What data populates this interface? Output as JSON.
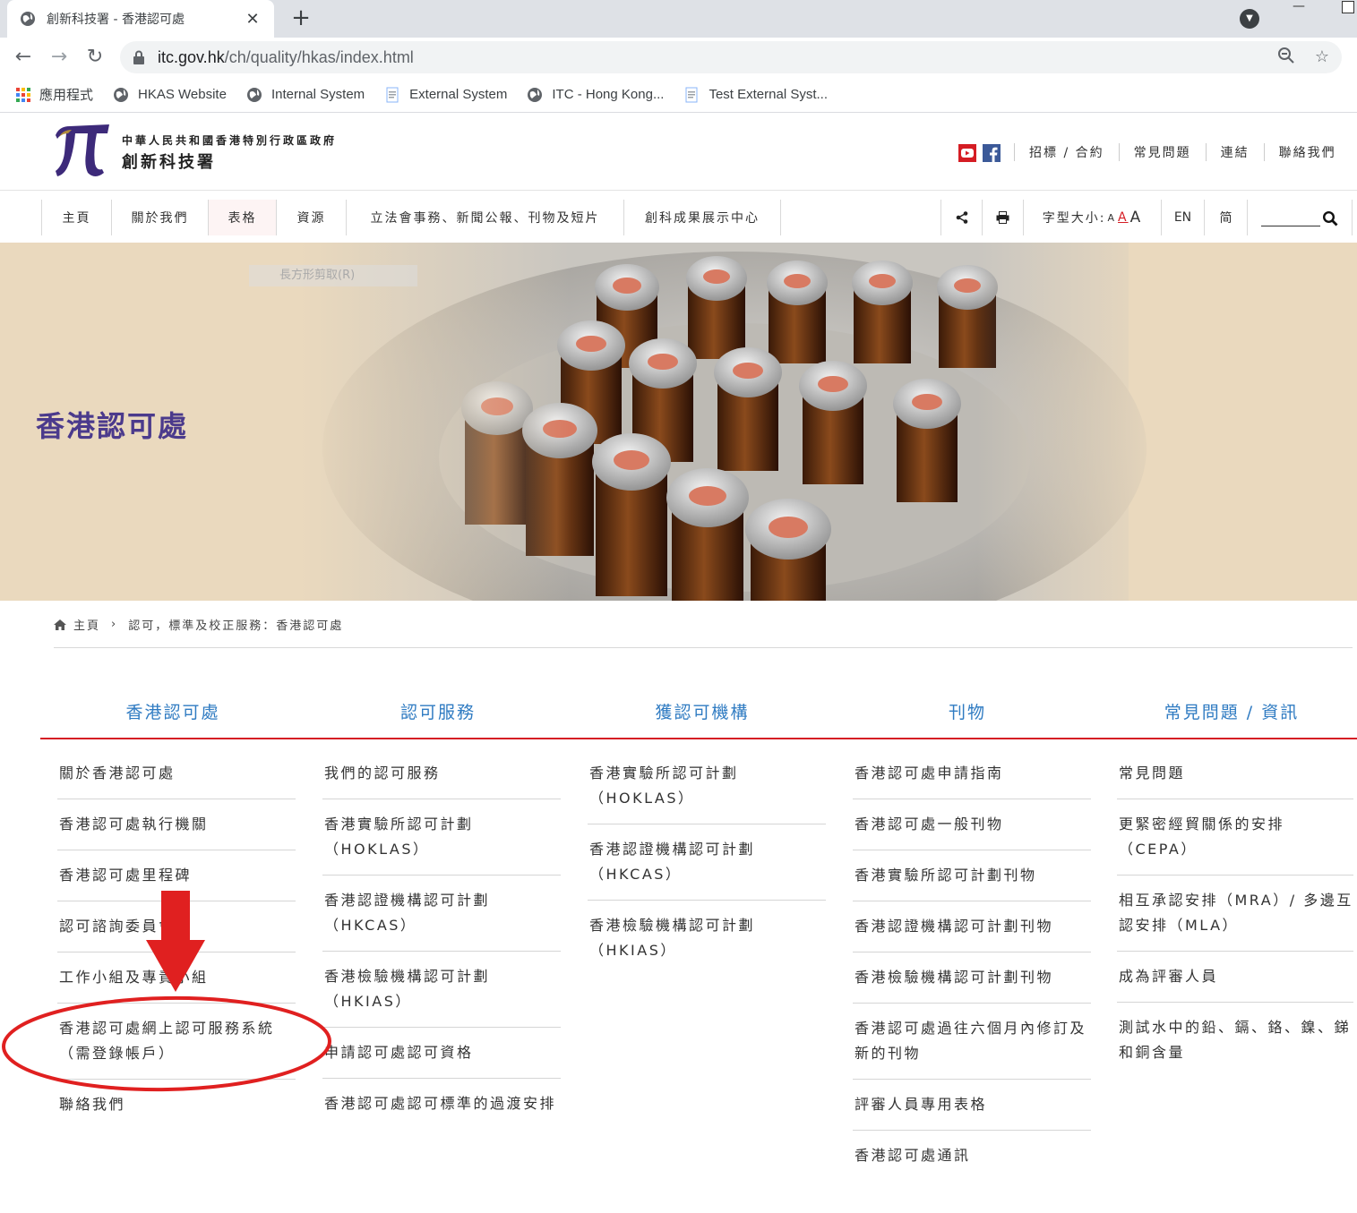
{
  "browser": {
    "tab_title": "創新科技署 - 香港認可處",
    "url_host": "itc.gov.hk",
    "url_path": "/ch/quality/hkas/index.html",
    "bookmarks": [
      {
        "label": "應用程式",
        "icon": "apps-grid-icon"
      },
      {
        "label": "HKAS Website",
        "icon": "globe-icon"
      },
      {
        "label": "Internal System",
        "icon": "globe-icon"
      },
      {
        "label": "External System",
        "icon": "document-icon"
      },
      {
        "label": "ITC - Hong Kong...",
        "icon": "globe-icon"
      },
      {
        "label": "Test  External Syst...",
        "icon": "document-icon"
      }
    ]
  },
  "header": {
    "gov_name": "中華人民共和國香港特別行政區政府",
    "dept_name": "創新科技署",
    "top_links": [
      "招標 / 合約",
      "常見問題",
      "連結",
      "聯絡我們"
    ]
  },
  "nav": {
    "items": [
      "主頁",
      "關於我們",
      "表格",
      "資源",
      "立法會事務、新聞公報、刊物及短片",
      "創科成果展示中心"
    ],
    "font_size_label": "字型大小:",
    "font_sizes": [
      "A",
      "A",
      "A"
    ],
    "lang_en": "EN",
    "lang_sc": "简"
  },
  "hero": {
    "title": "香港認可處",
    "ghost_menu": "長方形剪取(R)"
  },
  "breadcrumb": {
    "home": "主頁",
    "current": "認可，標準及校正服務：香港認可處"
  },
  "sitemap": {
    "columns": [
      {
        "header": "香港認可處",
        "items": [
          "關於香港認可處",
          "香港認可處執行機關",
          "香港認可處里程碑",
          "認可諮詢委員會",
          "工作小組及專責小組",
          "香港認可處網上認可服務系統（需登錄帳戶）",
          "聯絡我們"
        ]
      },
      {
        "header": "認可服務",
        "items": [
          "我們的認可服務",
          "香港實驗所認可計劃（HOKLAS）",
          "香港認證機構認可計劃（HKCAS）",
          "香港檢驗機構認可計劃（HKIAS）",
          "申請認可處認可資格",
          "香港認可處認可標準的過渡安排"
        ]
      },
      {
        "header": "獲認可機構",
        "items": [
          "香港實驗所認可計劃（HOKLAS）",
          "香港認證機構認可計劃（HKCAS）",
          "香港檢驗機構認可計劃（HKIAS）"
        ]
      },
      {
        "header": "刊物",
        "items": [
          "香港認可處申請指南",
          "香港認可處一般刊物",
          "香港實驗所認可計劃刊物",
          "香港認證機構認可計劃刊物",
          "香港檢驗機構認可計劃刊物",
          "香港認可處過往六個月內修訂及新的刊物",
          "評審人員專用表格",
          "香港認可處通訊"
        ]
      },
      {
        "header": "常見問題 / 資訊",
        "items": [
          "常見問題",
          "更緊密經貿關係的安排（CEPA）",
          "相互承認安排（MRA）/ 多邊互認安排（MLA）",
          "成為評審人員",
          "測試水中的鉛、鎘、鉻、鎳、銻和銅含量"
        ]
      }
    ]
  },
  "colors": {
    "link_blue": "#2f7bc2",
    "accent_red": "#d51d24",
    "hero_title": "#4b3a8c",
    "annotation_red": "#e02020"
  }
}
